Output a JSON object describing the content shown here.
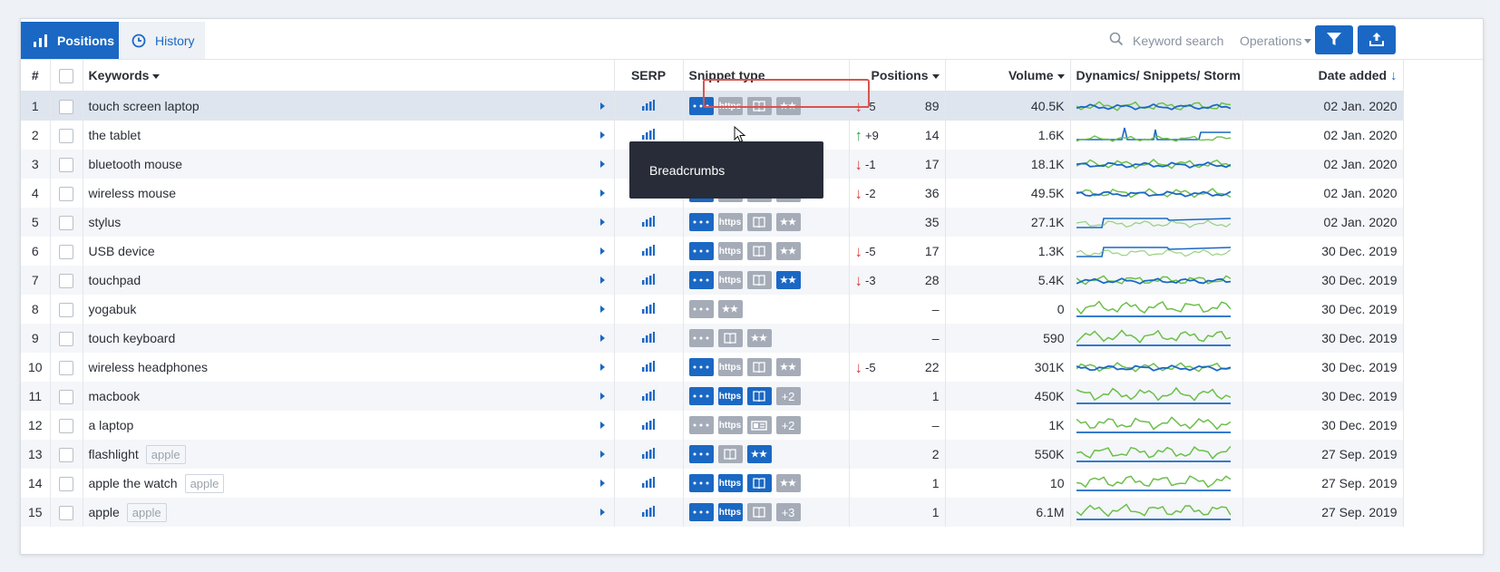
{
  "toolbar": {
    "tabs": [
      {
        "label": "Positions",
        "active": true
      },
      {
        "label": "History",
        "active": false
      }
    ],
    "search_placeholder": "Keyword search",
    "operations_label": "Operations"
  },
  "columns": {
    "num": "#",
    "keywords": "Keywords",
    "serp": "SERP",
    "snippet": "Snippet type",
    "positions": "Positions",
    "volume": "Volume",
    "dynamics": "Dynamics/ Snippets/ Storm",
    "date": "Date added"
  },
  "tooltip": "Breadcrumbs",
  "colors": {
    "accent": "#1a68c4",
    "down": "#d93a3a",
    "up": "#2e9b4e",
    "chart_green": "#6cbf4b"
  },
  "rows": [
    {
      "num": "1",
      "keyword": "touch screen laptop",
      "tag": "",
      "snippets": [
        {
          "t": "dots",
          "on": true
        },
        {
          "t": "https",
          "on": false
        },
        {
          "t": "book",
          "on": false
        },
        {
          "t": "stars",
          "on": false
        }
      ],
      "change": "-5",
      "dir": "down",
      "position": "89",
      "volume": "40.5K",
      "date": "02 Jan. 2020",
      "spark": "blue-green"
    },
    {
      "num": "2",
      "keyword": "the tablet",
      "tag": "",
      "snippets": [],
      "change": "+9",
      "dir": "up",
      "position": "14",
      "volume": "1.6K",
      "date": "02 Jan. 2020",
      "spark": "green-spikes"
    },
    {
      "num": "3",
      "keyword": "bluetooth mouse",
      "tag": "",
      "snippets": [],
      "change": "-1",
      "dir": "down",
      "position": "17",
      "volume": "18.1K",
      "date": "02 Jan. 2020",
      "spark": "blue-green"
    },
    {
      "num": "4",
      "keyword": "wireless mouse",
      "tag": "",
      "snippets": [
        {
          "t": "dots",
          "on": true
        },
        {
          "t": "https",
          "on": false
        },
        {
          "t": "book",
          "on": false
        },
        {
          "t": "stars",
          "on": false
        }
      ],
      "change": "-2",
      "dir": "down",
      "position": "36",
      "volume": "49.5K",
      "date": "02 Jan. 2020",
      "spark": "blue-green"
    },
    {
      "num": "5",
      "keyword": "stylus",
      "tag": "",
      "snippets": [
        {
          "t": "dots",
          "on": true
        },
        {
          "t": "https",
          "on": false
        },
        {
          "t": "book",
          "on": false
        },
        {
          "t": "stars",
          "on": false
        }
      ],
      "change": "",
      "dir": "",
      "position": "35",
      "volume": "27.1K",
      "date": "02 Jan. 2020",
      "spark": "blue-step"
    },
    {
      "num": "6",
      "keyword": "USB device",
      "tag": "",
      "snippets": [
        {
          "t": "dots",
          "on": true
        },
        {
          "t": "https",
          "on": false
        },
        {
          "t": "book",
          "on": false
        },
        {
          "t": "stars",
          "on": false
        }
      ],
      "change": "-5",
      "dir": "down",
      "position": "17",
      "volume": "1.3K",
      "date": "30 Dec. 2019",
      "spark": "blue-step"
    },
    {
      "num": "7",
      "keyword": "touchpad",
      "tag": "",
      "snippets": [
        {
          "t": "dots",
          "on": true
        },
        {
          "t": "https",
          "on": false
        },
        {
          "t": "book",
          "on": false
        },
        {
          "t": "stars",
          "on": true
        }
      ],
      "change": "-3",
      "dir": "down",
      "position": "28",
      "volume": "5.4K",
      "date": "30 Dec. 2019",
      "spark": "blue-green"
    },
    {
      "num": "8",
      "keyword": "yogabuk",
      "tag": "",
      "snippets": [
        {
          "t": "dots",
          "on": false
        },
        {
          "t": "stars",
          "on": false
        }
      ],
      "change": "",
      "dir": "",
      "position": "–",
      "volume": "0",
      "date": "30 Dec. 2019",
      "spark": "green-line"
    },
    {
      "num": "9",
      "keyword": "touch keyboard",
      "tag": "",
      "snippets": [
        {
          "t": "dots",
          "on": false
        },
        {
          "t": "book",
          "on": false
        },
        {
          "t": "stars",
          "on": false
        }
      ],
      "change": "",
      "dir": "",
      "position": "–",
      "volume": "590",
      "date": "30 Dec. 2019",
      "spark": "green-line"
    },
    {
      "num": "10",
      "keyword": "wireless headphones",
      "tag": "",
      "snippets": [
        {
          "t": "dots",
          "on": true
        },
        {
          "t": "https",
          "on": false
        },
        {
          "t": "book",
          "on": false
        },
        {
          "t": "stars",
          "on": false
        }
      ],
      "change": "-5",
      "dir": "down",
      "position": "22",
      "volume": "301K",
      "date": "30 Dec. 2019",
      "spark": "blue-green"
    },
    {
      "num": "11",
      "keyword": "macbook",
      "tag": "",
      "snippets": [
        {
          "t": "dots",
          "on": true
        },
        {
          "t": "https",
          "on": true
        },
        {
          "t": "book",
          "on": true
        },
        {
          "t": "more",
          "on": false,
          "label": "+2"
        }
      ],
      "change": "",
      "dir": "",
      "position": "1",
      "volume": "450K",
      "date": "30 Dec. 2019",
      "spark": "green-line"
    },
    {
      "num": "12",
      "keyword": "a laptop",
      "tag": "",
      "snippets": [
        {
          "t": "dots",
          "on": false
        },
        {
          "t": "https",
          "on": false
        },
        {
          "t": "card",
          "on": false
        },
        {
          "t": "more",
          "on": false,
          "label": "+2"
        }
      ],
      "change": "",
      "dir": "",
      "position": "–",
      "volume": "1K",
      "date": "30 Dec. 2019",
      "spark": "green-line"
    },
    {
      "num": "13",
      "keyword": "flashlight",
      "tag": "apple",
      "snippets": [
        {
          "t": "dots",
          "on": true
        },
        {
          "t": "book",
          "on": false
        },
        {
          "t": "stars",
          "on": true
        }
      ],
      "change": "",
      "dir": "",
      "position": "2",
      "volume": "550K",
      "date": "27 Sep. 2019",
      "spark": "green-line"
    },
    {
      "num": "14",
      "keyword": "apple the watch",
      "tag": "apple",
      "snippets": [
        {
          "t": "dots",
          "on": true
        },
        {
          "t": "https",
          "on": true
        },
        {
          "t": "book",
          "on": true
        },
        {
          "t": "stars",
          "on": false
        }
      ],
      "change": "",
      "dir": "",
      "position": "1",
      "volume": "10",
      "date": "27 Sep. 2019",
      "spark": "green-line"
    },
    {
      "num": "15",
      "keyword": "apple",
      "tag": "apple",
      "snippets": [
        {
          "t": "dots",
          "on": true
        },
        {
          "t": "https",
          "on": true
        },
        {
          "t": "book",
          "on": false
        },
        {
          "t": "more",
          "on": false,
          "label": "+3"
        }
      ],
      "change": "",
      "dir": "",
      "position": "1",
      "volume": "6.1M",
      "date": "27 Sep. 2019",
      "spark": "green-line"
    }
  ]
}
